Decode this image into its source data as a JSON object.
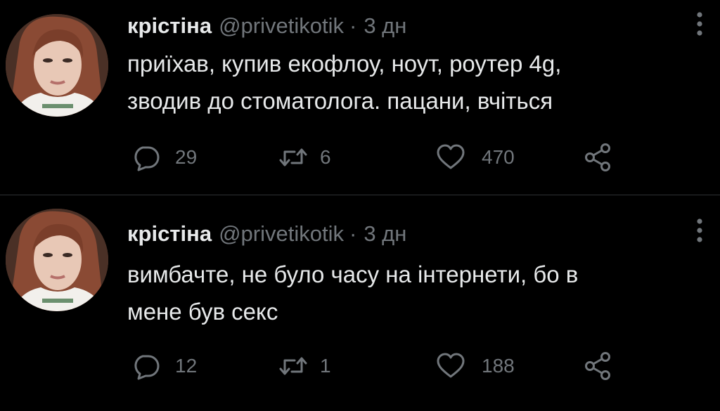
{
  "colors": {
    "background": "#000000",
    "text_primary": "#e7e9ea",
    "text_secondary": "#71767b",
    "divider": "#2f3336"
  },
  "icons": {
    "reply": "speech-bubble",
    "retweet": "retweet-arrows",
    "like": "heart-outline",
    "share": "share-nodes",
    "more": "vertical-ellipsis"
  },
  "tweets": [
    {
      "display_name": "крістіна",
      "handle": "@privetikotik",
      "separator": "·",
      "time": "3 дн",
      "text": "приїхав, купив екофлоу, ноут, роутер 4g,\nзводив до стоматолога. пацани, вчіться",
      "replies": "29",
      "retweets": "6",
      "likes": "470"
    },
    {
      "display_name": "крістіна",
      "handle": "@privetikotik",
      "separator": "·",
      "time": "3 дн",
      "text": "вимбачте, не було часу на інтернети, бо в\nмене був секс",
      "replies": "12",
      "retweets": "1",
      "likes": "188"
    }
  ]
}
